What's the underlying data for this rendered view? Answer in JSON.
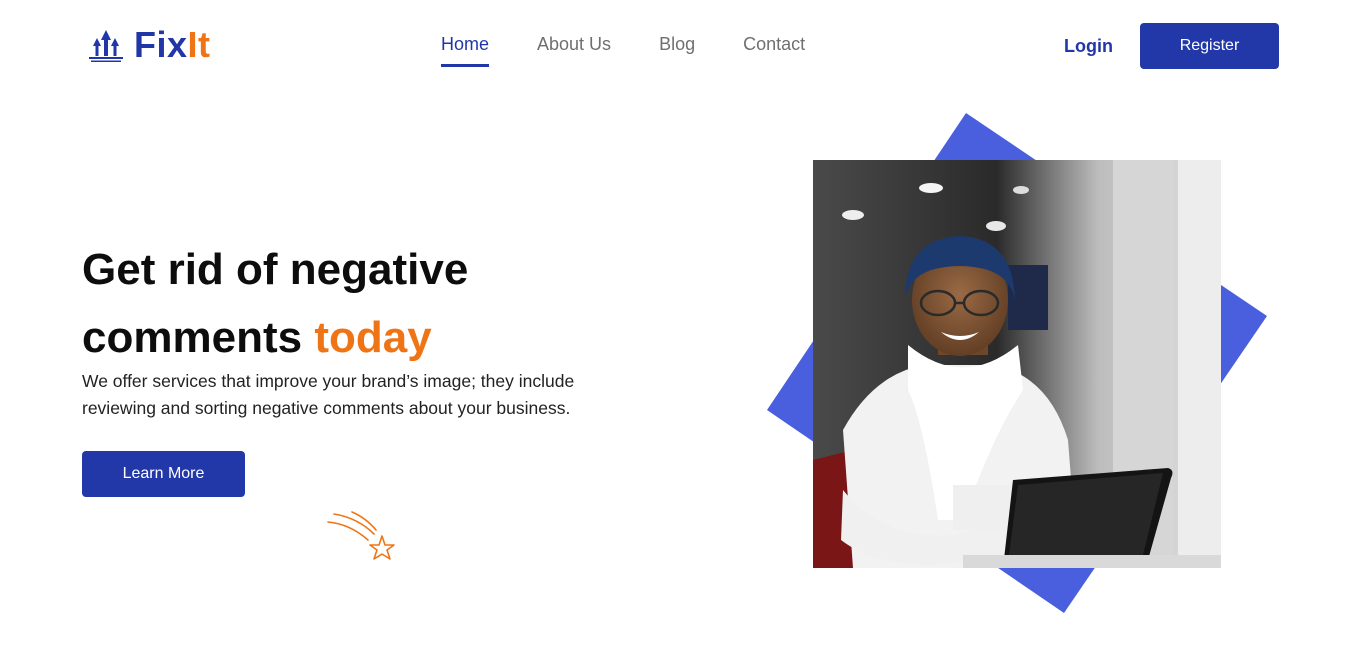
{
  "brand": {
    "part1": "Fix",
    "part2": "It"
  },
  "nav": {
    "items": [
      {
        "label": "Home",
        "active": true
      },
      {
        "label": "About Us",
        "active": false
      },
      {
        "label": "Blog",
        "active": false
      },
      {
        "label": "Contact",
        "active": false
      }
    ]
  },
  "auth": {
    "login_label": "Login",
    "register_label": "Register"
  },
  "hero": {
    "title_line1": "Get rid of negative",
    "title_line2_prefix": "comments",
    "title_line2_accent": "today",
    "subtitle": "We offer services that improve your brand’s image; they include reviewing and sorting negative comments about your business.",
    "cta_label": "Learn More"
  },
  "colors": {
    "primary": "#2338a8",
    "accent": "#ee7416",
    "diamond": "#4a5fdd"
  },
  "icons": {
    "logo": "logo-arrows-icon",
    "decoration": "shooting-star-icon"
  }
}
